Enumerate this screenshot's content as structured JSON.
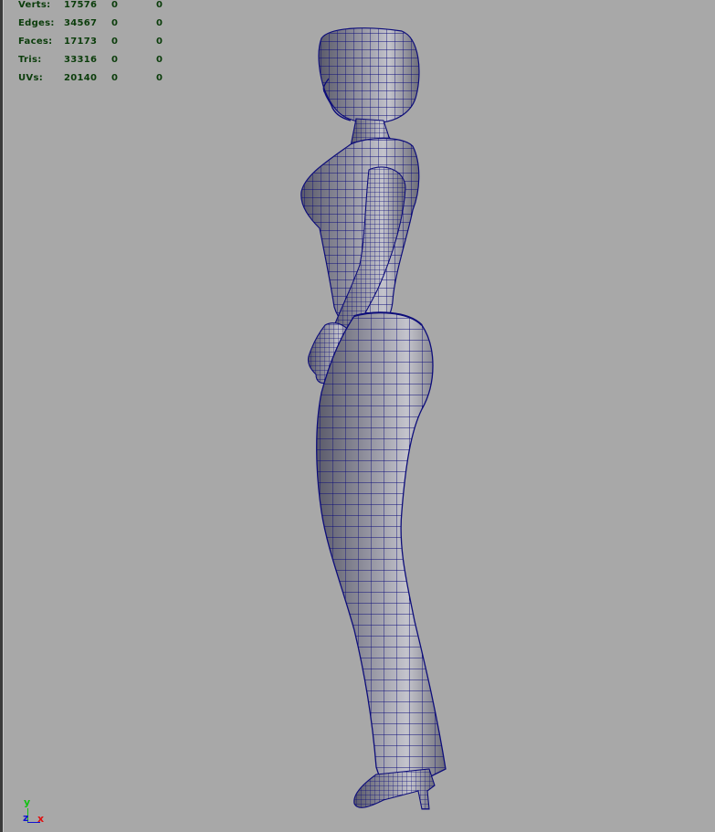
{
  "viewport": {
    "name": "perspective-viewport",
    "background": "#a8a8a8",
    "wire_color": "#0d0d7a"
  },
  "hud": {
    "rows": [
      {
        "label": "Verts:",
        "values": [
          "17576",
          "0",
          "0"
        ]
      },
      {
        "label": "Edges:",
        "values": [
          "34567",
          "0",
          "0"
        ]
      },
      {
        "label": "Faces:",
        "values": [
          "17173",
          "0",
          "0"
        ]
      },
      {
        "label": "Tris:",
        "values": [
          "33316",
          "0",
          "0"
        ]
      },
      {
        "label": "UVs:",
        "values": [
          "20140",
          "0",
          "0"
        ]
      }
    ],
    "text_color": "#0b3d0b"
  },
  "axis_gizmo": {
    "y": "y",
    "z": "z",
    "x": "x",
    "colors": {
      "y": "#13c113",
      "z": "#1212d0",
      "x": "#e01010"
    }
  },
  "model": {
    "icon": "wireframe-female-character-side-view"
  }
}
